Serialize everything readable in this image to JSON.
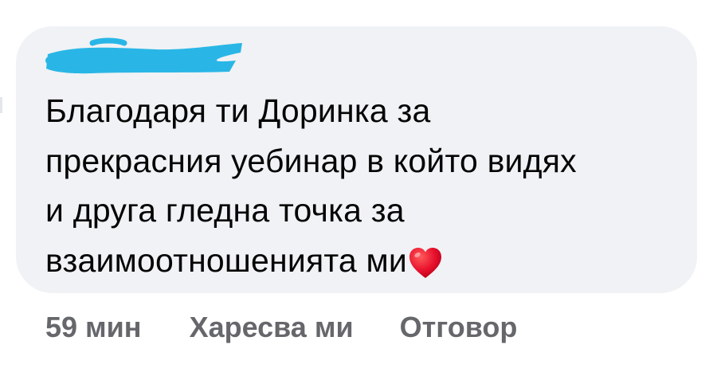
{
  "comment": {
    "author_name": "─── ·────",
    "text": "Благодаря ти Доринка за прекрасния уебинар в който видях и друга гледна точка за взаимоотношенията ми",
    "lines": [
      "Благодаря ти Доринка за",
      "прекрасния уебинар в който видях",
      "и друга гледна точка за",
      "взаимоотношенията ми"
    ],
    "emoji": "heart-emoji",
    "bubble_color": "#f0f2f5",
    "redaction_color": "#29b6e6"
  },
  "actions": {
    "time": "59 мин",
    "like_label": "Харесва ми",
    "reply_label": "Отговор",
    "color": "#65676b"
  }
}
